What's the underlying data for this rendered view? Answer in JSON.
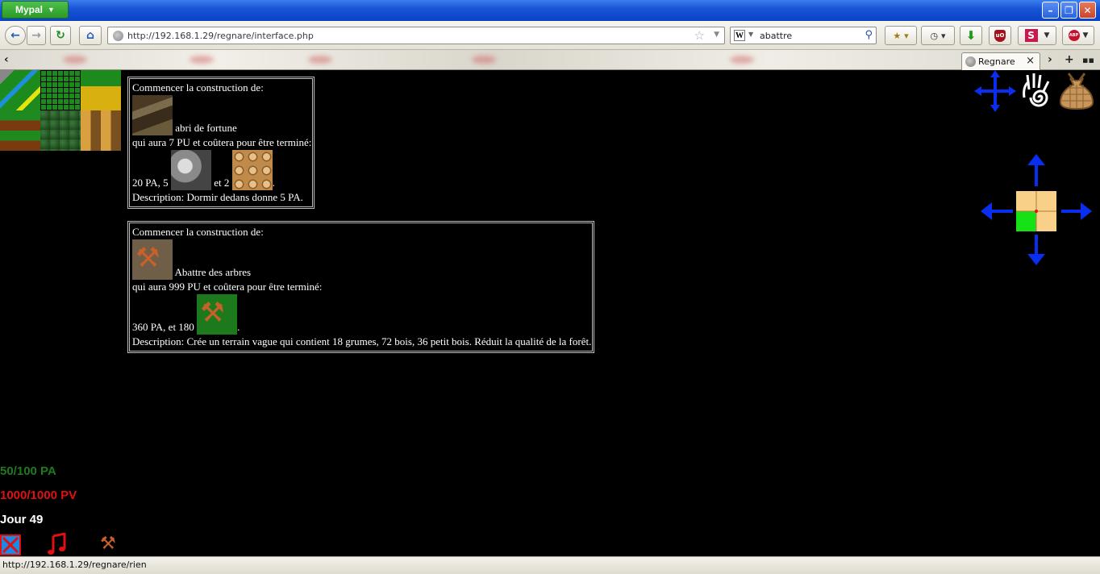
{
  "browser": {
    "app_menu_label": "Mypal",
    "url": "http://192.168.1.29/regnare/interface.php",
    "search_value": "abattre",
    "search_engine_letter": "W",
    "tab_title": "Regnare",
    "status_url": "http://192.168.1.29/regnare/rien"
  },
  "constructions": [
    {
      "heading": "Commencer la construction de:",
      "name": "abri de fortune",
      "pu_line": "qui aura 7 PU et coûtera pour être terminé:",
      "cost_pa": "20 PA, 5",
      "cost_and": "et 2",
      "cost_end": ".",
      "description": "Description: Dormir dedans donne 5 PA."
    },
    {
      "heading": "Commencer la construction de:",
      "name": "Abattre des arbres",
      "pu_line": "qui aura 999 PU et coûtera pour être terminé:",
      "cost_pa": "360 PA, et 180",
      "cost_end": ".",
      "description": "Description: Crée un terrain vague qui contient 18 grumes, 72 bois, 36 petit bois. Réduit la qualité de la forêt."
    }
  ],
  "stats": {
    "pa": "50/100 PA",
    "pv": "1000/1000 PV",
    "day": "Jour 49"
  },
  "colors": {
    "pa": "#1e7a1e",
    "pv": "#e01010",
    "day": "#ffffff",
    "arrow": "#0a2ef0"
  }
}
